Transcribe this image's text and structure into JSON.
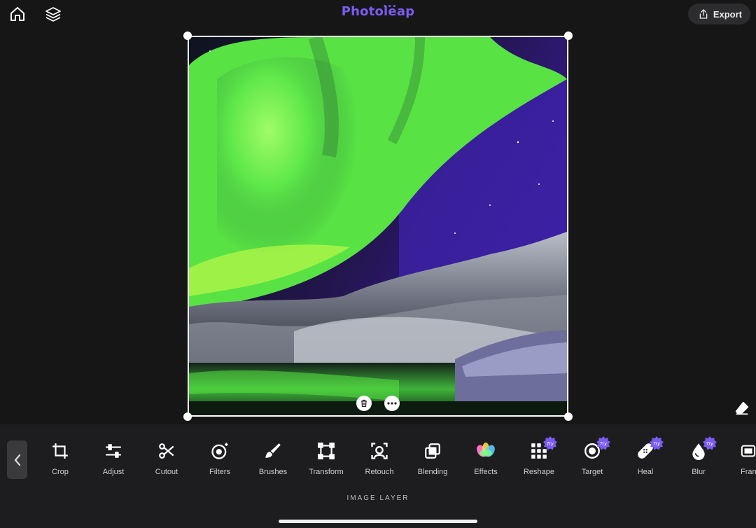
{
  "app": {
    "logo": "Photoleap"
  },
  "header": {
    "export_label": "Export",
    "icons": [
      "home-icon",
      "layers-icon",
      "share-icon"
    ]
  },
  "canvas": {
    "image": "aurora-borealis-over-snowy-hills",
    "canvas_icons": [
      "trash-icon",
      "more-icon",
      "eraser-icon"
    ]
  },
  "toolbar": {
    "tools": [
      {
        "label": "Crop",
        "icon": "crop-icon",
        "try": false
      },
      {
        "label": "Adjust",
        "icon": "adjust-icon",
        "try": false
      },
      {
        "label": "Cutout",
        "icon": "scissors-icon",
        "try": false
      },
      {
        "label": "Filters",
        "icon": "filters-icon",
        "try": false
      },
      {
        "label": "Brushes",
        "icon": "brush-icon",
        "try": false
      },
      {
        "label": "Transform",
        "icon": "transform-icon",
        "try": false
      },
      {
        "label": "Retouch",
        "icon": "retouch-icon",
        "try": false
      },
      {
        "label": "Blending",
        "icon": "blending-icon",
        "try": false
      },
      {
        "label": "Effects",
        "icon": "effects-icon",
        "try": false
      },
      {
        "label": "Reshape",
        "icon": "reshape-icon",
        "try": true
      },
      {
        "label": "Target",
        "icon": "target-icon",
        "try": true
      },
      {
        "label": "Heal",
        "icon": "heal-icon",
        "try": true
      },
      {
        "label": "Blur",
        "icon": "blur-icon",
        "try": true
      },
      {
        "label": "Fran",
        "icon": "frame-icon",
        "try": false
      }
    ],
    "try_badge": "Try",
    "section_label": "IMAGE LAYER"
  },
  "colors": {
    "brand": "#7b5cf0",
    "background": "#161616",
    "toolbar": "#1d1d1f",
    "try_badge": "#7b5cf0"
  }
}
